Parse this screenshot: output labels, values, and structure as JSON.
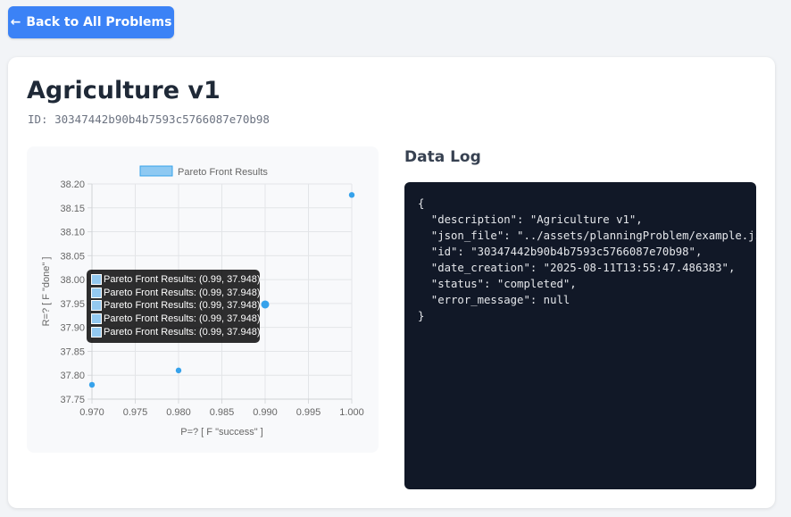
{
  "nav": {
    "back_label": "Back to All Problems",
    "back_icon": "arrow-left-icon"
  },
  "problem": {
    "title": "Agriculture v1",
    "id_line": "ID: 30347442b90b4b7593c5766087e70b98"
  },
  "chart_data": {
    "type": "scatter",
    "title": "",
    "legend": [
      "Pareto Front Results"
    ],
    "legend_position": "top",
    "xlabel": "P=? [ F \"success\" ]",
    "ylabel": "R=? [ F \"done\" ]",
    "xlim": [
      0.97,
      1.0
    ],
    "ylim": [
      37.75,
      38.2
    ],
    "x_ticks": [
      "0.970",
      "0.975",
      "0.980",
      "0.985",
      "0.990",
      "0.995",
      "1.000"
    ],
    "y_ticks": [
      "37.75",
      "37.80",
      "37.85",
      "37.90",
      "37.95",
      "38.00",
      "38.05",
      "38.10",
      "38.15",
      "38.20"
    ],
    "grid": true,
    "series": [
      {
        "name": "Pareto Front Results",
        "color": "#36a2eb",
        "points": [
          {
            "x": 0.97,
            "y": 37.78
          },
          {
            "x": 0.98,
            "y": 37.81
          },
          {
            "x": 0.99,
            "y": 37.948
          },
          {
            "x": 1.0,
            "y": 38.177
          }
        ]
      }
    ],
    "highlighted_point": {
      "x": 0.99,
      "y": 37.948
    },
    "tooltip_lines": [
      "Pareto Front Results: (0.99, 37.948)",
      "Pareto Front Results: (0.99, 37.948)",
      "Pareto Front Results: (0.99, 37.948)",
      "Pareto Front Results: (0.99, 37.948)",
      "Pareto Front Results: (0.99, 37.948)"
    ]
  },
  "log": {
    "heading": "Data Log",
    "lines": [
      "{",
      "  \"description\": \"Agriculture v1\",",
      "  \"json_file\": \"../assets/planningProblem/example.json\",",
      "  \"id\": \"30347442b90b4b7593c5766087e70b98\",",
      "  \"date_creation\": \"2025-08-11T13:55:47.486383\",",
      "  \"status\": \"completed\",",
      "  \"error_message\": null",
      "}"
    ]
  },
  "colors": {
    "accent": "#3b82f6",
    "log_background": "#111827",
    "point": "#36a2eb",
    "legend_swatch": "#93c9f0"
  }
}
